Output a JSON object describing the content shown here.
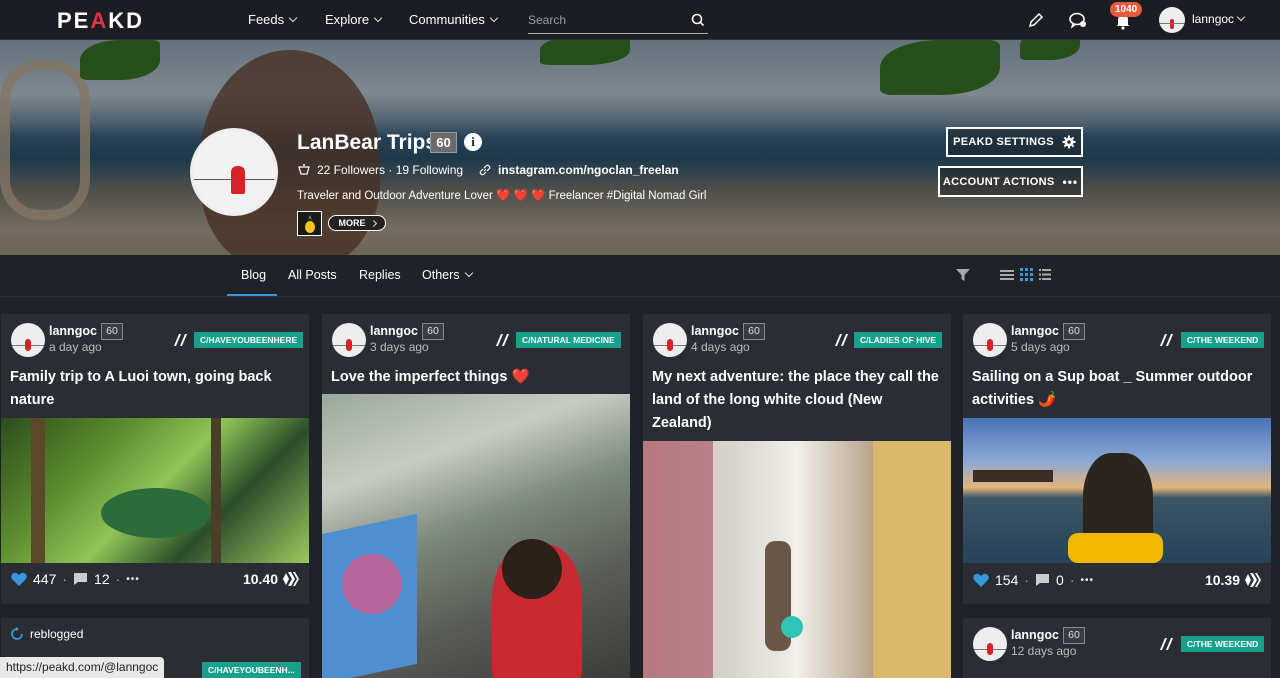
{
  "nav": {
    "logo_pre": "PE",
    "logo_a": "A",
    "logo_post": "KD",
    "feeds": "Feeds",
    "explore": "Explore",
    "communities": "Communities",
    "search_placeholder": "Search",
    "notifications_count": "1040",
    "username": "lanngoc"
  },
  "profile": {
    "name": "LanBear Trips",
    "reputation": "60",
    "info": "i",
    "followers": "22 Followers · 19 Following",
    "link": "instagram.com/ngoclan_freelan",
    "bio_start": "Traveler and Outdoor Adventure Lover",
    "bio_hearts": "❤️ ❤️ ❤️",
    "bio_end": "Freelancer #Digital Nomad Girl",
    "more": "MORE",
    "peakd_settings": "PEAKD SETTINGS",
    "account_actions": "ACCOUNT ACTIONS"
  },
  "tabs": {
    "blog": "Blog",
    "all_posts": "All Posts",
    "replies": "Replies",
    "others": "Others"
  },
  "posts": [
    {
      "author": "lanngoc",
      "rep": "60",
      "when": "a day ago",
      "community": "C/HAVEYOUBEENHERE",
      "title": "Family trip to A Luoi town, going back nature",
      "votes": "447",
      "comments": "12",
      "payout": "10.40",
      "more": "•••"
    },
    {
      "author": "lanngoc",
      "rep": "60",
      "when": "3 days ago",
      "community": "C/NATURAL MEDICINE",
      "title": "Love the imperfect things ❤️"
    },
    {
      "author": "lanngoc",
      "rep": "60",
      "when": "4 days ago",
      "community": "C/LADIES OF HIVE",
      "title": "My next adventure: the place they call the land of the long white cloud (New Zealand)"
    },
    {
      "author": "lanngoc",
      "rep": "60",
      "when": "5 days ago",
      "community": "C/THE WEEKEND",
      "title": "Sailing on a Sup boat _ Summer outdoor activities 🌶️",
      "votes": "154",
      "comments": "0",
      "payout": "10.39",
      "more": "•••"
    }
  ],
  "second_row": {
    "reblogged": "reblogged",
    "left_community": "C/HAVEYOUBEENH...",
    "right_author": "lanngoc",
    "right_rep": "60",
    "right_when": "12 days ago",
    "right_community": "C/THE WEEKEND"
  },
  "status_url": "https://peakd.com/@lanngoc",
  "colors": {
    "accent": "#3498db",
    "community": "#18a08a",
    "notification": "#e85b3a",
    "vote": "#3498db"
  }
}
